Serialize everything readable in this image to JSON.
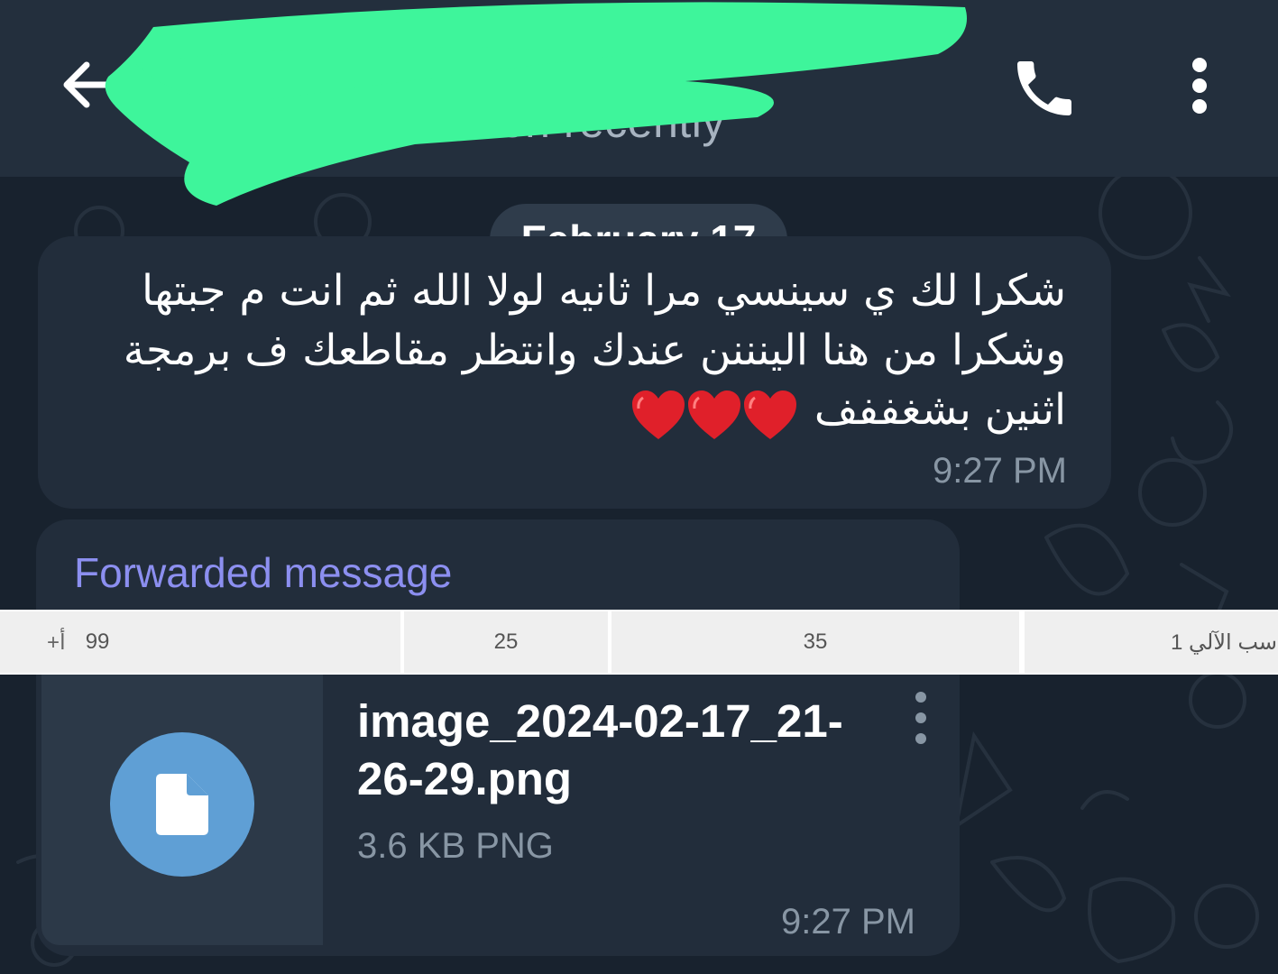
{
  "header": {
    "status_text": "seen recently",
    "back_icon": "arrow-left-icon",
    "call_icon": "phone-icon",
    "more_icon": "vertical-dots-icon"
  },
  "date_chip": "February 17",
  "message1": {
    "lines": [
      "شكرا لك ي سينسي مرا ثانيه لولا الله ثم انت م جبتها",
      "وشكرا من هنا الينننن عندك وانتظر مقاطعك ف برمجة",
      "اثنين بشغففف"
    ],
    "emoji": "❤️❤️❤️",
    "time": "9:27 PM"
  },
  "message2": {
    "forwarded_label": "Forwarded message",
    "file_name_line1": "image_2024-02-17_21-",
    "file_name_line2": "26-29.png",
    "file_meta": "3.6 KB PNG",
    "time": "9:27 PM",
    "file_icon": "document-icon"
  },
  "suggestion_strip": {
    "cell1_plus": "+أ",
    "cell1_value": "99",
    "cell2_value": "25",
    "cell3_value": "35",
    "cell4_value": "سب الآلي 1"
  },
  "colors": {
    "header_bg": "#232f3d",
    "chat_bg": "#18222e",
    "bubble_bg": "#222d3b",
    "forwarded_accent": "#8c8ff0",
    "file_icon_bg": "#5f9fd5",
    "redaction": "#3ef59b"
  }
}
